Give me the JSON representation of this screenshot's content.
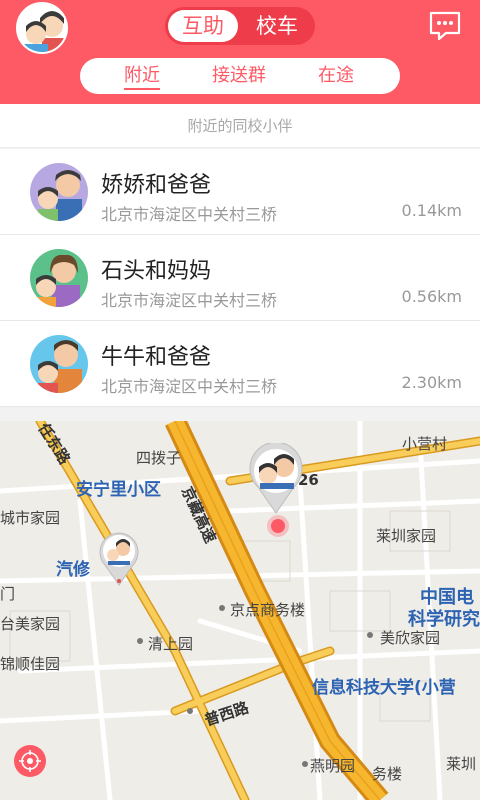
{
  "header": {
    "tabs": [
      "互助",
      "校车"
    ],
    "subtabs": [
      "附近",
      "接送群",
      "在途"
    ]
  },
  "section_label": "附近的同校小伴",
  "list": [
    {
      "name": "娇娇和爸爸",
      "address": "北京市海淀区中关村三桥",
      "distance": "0.14km"
    },
    {
      "name": "石头和妈妈",
      "address": "北京市海淀区中关村三桥",
      "distance": "0.56km"
    },
    {
      "name": "牛牛和爸爸",
      "address": "北京市海淀区中关村三桥",
      "distance": "2.30km"
    }
  ],
  "map": {
    "labels": {
      "wang_fu": "任东路",
      "si_bo_zi": "四拨子",
      "xiao_ying": "小营村",
      "an_ning": "安宁里小区",
      "jing_zang": "京藏高速",
      "num26": "26",
      "lai_guang": "莱圳家园",
      "cheng_shi": "城市家园",
      "qi_xiu": "汽修",
      "men": "门",
      "zhong_guo": "中国电",
      "ke_xue": "科学研究",
      "tai_mei": "台美家园",
      "jing_dian": "京点商务楼",
      "mei_xin": "美欣家园",
      "qing_shang": "清上园",
      "jin_shun": "锦顺佳园",
      "xin_xi": "信息科技大学(小营",
      "jing_xi": "普西路",
      "yan_ming": "燕明园",
      "wu_lou": "务楼",
      "lai_lin": "莱圳"
    }
  },
  "colors": {
    "accent": "#fd5a66",
    "road": "#f6b93b",
    "road_main": "#e8a21f"
  }
}
